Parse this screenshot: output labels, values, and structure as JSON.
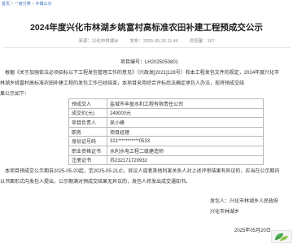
{
  "breadcrumb": {
    "home": "首页",
    "level2": "一级分类",
    "current": "乡镇公示"
  },
  "article": {
    "title": "2024年度兴化市林湖乡姚富村高标准农田补建工程预成交公示",
    "meta": {
      "source": "来源：兴化市林湖乡",
      "date": "发布：2025-05-20 11:46",
      "views": "浏览量：167"
    },
    "project_code": "项目编号：LH2025050801",
    "paragraphs": [
      "根据《关于加强依法必须招标以下工程发包管理工作的意见》（兴政发[2021]128号）和本工程发包文件的规定，2024年度兴化市",
      "林湖乡姚富村高标准农田补建工程的发包工作已经结束，本项目采用综合评标后法确定承包人办法，现将预成交结",
      "果公示如下："
    ],
    "info_rows": [
      {
        "label": "预成交人",
        "value": "盐城市丰盈水利工程有限责任公司"
      },
      {
        "label": "成交价(元)",
        "value": "249000元"
      },
      {
        "label": "项目负责人",
        "value": "吴小峰"
      },
      {
        "label": "职务",
        "value": "项目经理"
      },
      {
        "label": "身份证号码",
        "value": "321***********0533"
      },
      {
        "label": "职业资格证书",
        "value": "水利水电工程二级建造师"
      },
      {
        "label": "注册证书",
        "value": "苏232171720932"
      }
    ],
    "closing": [
      "本项目预成交公示期自2025-05-20起，至2025-05-21止。异议人或者其他利害关系人对上述评审结果有异议的，应当在公示期内",
      "以书面形式向发包人提出，公示期满对预成交结果无异议的，发包人将发出成交通知书。"
    ],
    "signature": {
      "org": "发包人：兴化市林湖乡人民政府",
      "dept": "兴化市林湖乡",
      "date": "2025年05月20日"
    }
  }
}
